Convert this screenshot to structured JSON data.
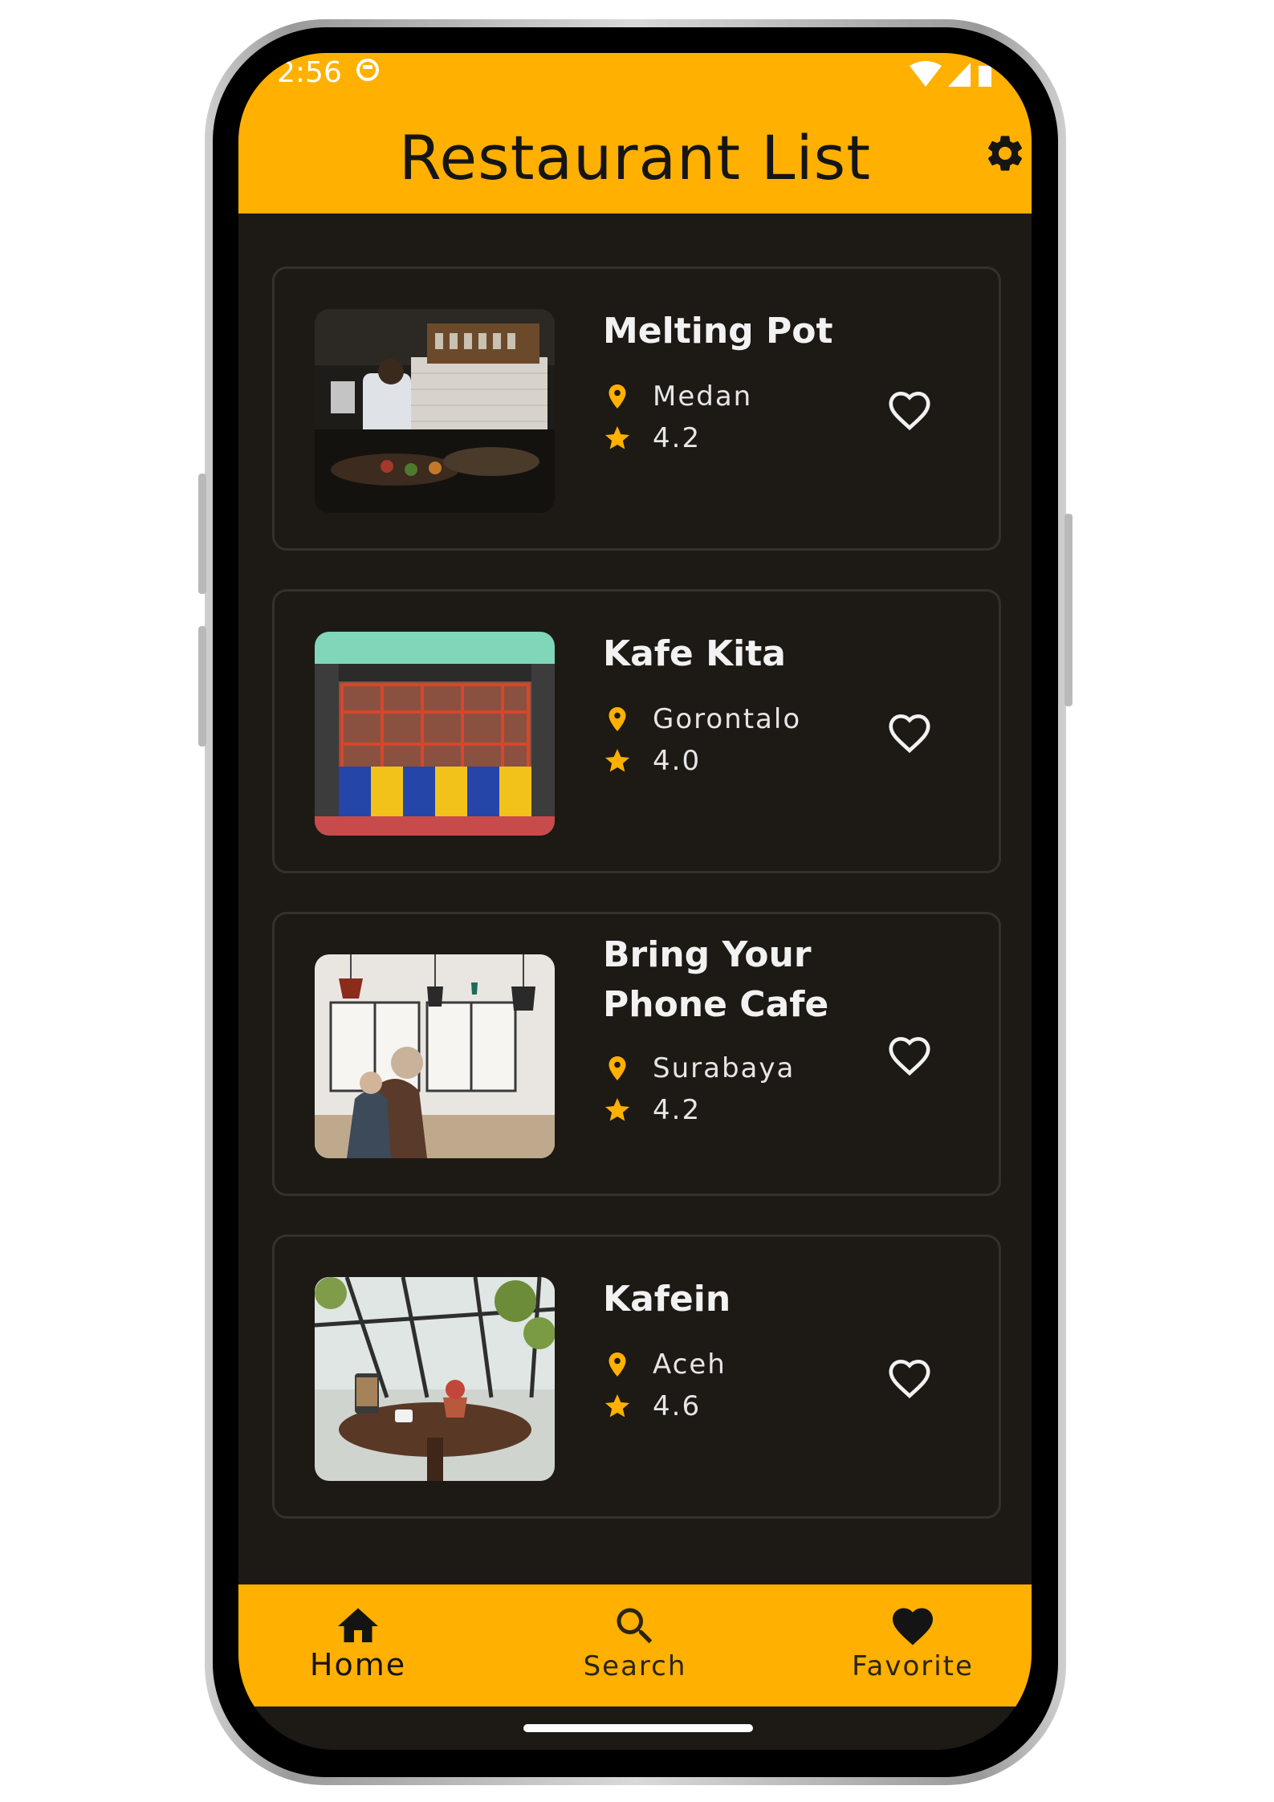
{
  "status_bar": {
    "time": "2:56"
  },
  "app_bar": {
    "title": "Restaurant List",
    "settings_icon": "gear-icon"
  },
  "colors": {
    "accent": "#ffb000",
    "background": "#1d1915",
    "card_border": "#34302b",
    "text_primary": "#f2f2f2"
  },
  "restaurants": [
    {
      "name": "Melting Pot",
      "city": "Medan",
      "rating": "4.2"
    },
    {
      "name": "Kafe Kita",
      "city": "Gorontalo",
      "rating": "4.0"
    },
    {
      "name": "Bring Your Phone Cafe",
      "city": "Surabaya",
      "rating": "4.2"
    },
    {
      "name": "Kafein",
      "city": "Aceh",
      "rating": "4.6"
    }
  ],
  "bottom_nav": {
    "items": [
      {
        "label": "Home",
        "icon": "home-icon",
        "active": true
      },
      {
        "label": "Search",
        "icon": "search-icon",
        "active": false
      },
      {
        "label": "Favorite",
        "icon": "heart-icon",
        "active": false
      }
    ]
  }
}
